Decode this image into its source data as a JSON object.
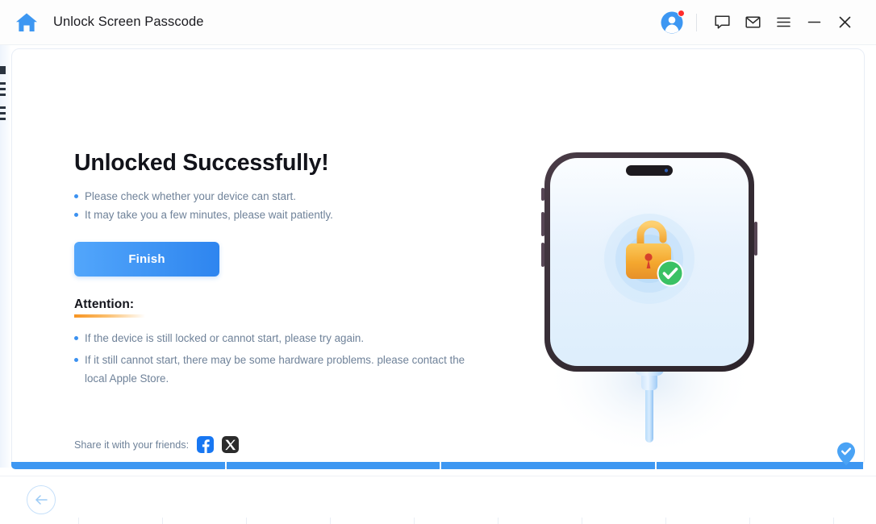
{
  "window": {
    "title": "Unlock Screen Passcode",
    "home_icon": "home-icon",
    "controls": {
      "account_icon": "account-avatar-icon",
      "notification_badge": "red-dot",
      "feedback_icon": "chat-bubble-icon",
      "mail_icon": "mail-envelope-icon",
      "menu_icon": "hamburger-menu-icon",
      "minimize_icon": "minimize-icon",
      "close_icon": "close-icon"
    }
  },
  "main": {
    "headline": "Unlocked Successfully!",
    "bullets": [
      "Please check whether your device can start.",
      "It may take you a few minutes, please wait patiently."
    ],
    "finish_button": "Finish",
    "attention": {
      "title": "Attention:",
      "bullets": [
        "If the device is still locked or cannot start, please try again.",
        "If it still cannot start, there may be some hardware problems. please contact the local Apple Store."
      ]
    },
    "share": {
      "label": "Share it with your friends:",
      "facebook_icon": "facebook-icon",
      "x_icon": "x-twitter-icon"
    }
  },
  "illustration": {
    "device": "iphone-device",
    "lock_icon": "open-padlock-icon",
    "success_icon": "green-check-icon",
    "cable_icon": "charging-cable-icon"
  },
  "progress": {
    "segments": 4,
    "completed": 4,
    "pin_icon": "check-pin-icon"
  },
  "footer": {
    "back_button_icon": "back-arrow-icon"
  },
  "colors": {
    "accent_blue": "#3d97f2",
    "button_gradient_start": "#52a6fb",
    "button_gradient_end": "#2e85ef",
    "bullet_blue": "#3b91f0",
    "body_text": "#6f8299",
    "heading_text": "#12131a",
    "attention_orange": "#f79421",
    "success_green": "#38c172",
    "lock_gold": "#f2a93b",
    "facebook_blue": "#1877f2",
    "x_black": "#2b2b2b",
    "notification_red": "#ff2d2d"
  }
}
